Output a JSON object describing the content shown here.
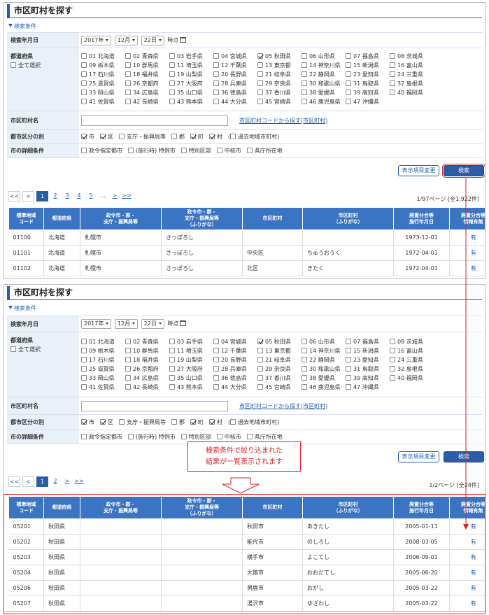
{
  "page_title": "市区町村を探す",
  "search_toggle": "検索条件",
  "labels": {
    "year_month": "検索年月日",
    "prefecture": "都道府県",
    "select_all": "全て選択",
    "municipality_name": "市区町村名",
    "municipality_type": "都市区分の別",
    "detail": "市の詳細条件"
  },
  "date": {
    "year": "2017年",
    "month": "12月",
    "day": "22日",
    "suffix": "時点"
  },
  "prefectures": [
    "01 北海道",
    "02 青森県",
    "03 岩手県",
    "04 宮城県",
    "05 秋田県",
    "06 山形県",
    "07 福島県",
    "08 茨城県",
    "09 栃木県",
    "10 群馬県",
    "11 埼玉県",
    "12 千葉県",
    "13 東京都",
    "14 神奈川県",
    "15 新潟県",
    "16 富山県",
    "17 石川県",
    "18 福井県",
    "19 山梨県",
    "20 長野県",
    "21 岐阜県",
    "22 静岡県",
    "23 愛知県",
    "24 三重県",
    "25 滋賀県",
    "26 京都府",
    "27 大阪府",
    "28 兵庫県",
    "29 奈良県",
    "30 和歌山県",
    "31 鳥取県",
    "32 島根県",
    "33 岡山県",
    "34 広島県",
    "35 山口県",
    "36 徳島県",
    "37 香川県",
    "38 愛媛県",
    "39 高知県",
    "40 福岡県",
    "41 佐賀県",
    "42 長崎県",
    "43 熊本県",
    "44 大分県",
    "45 宮崎県",
    "46 鹿児島県",
    "47 沖縄県"
  ],
  "municipality_link": "市区町村コードから探す(市区町村)",
  "types": [
    "市",
    "区",
    "支庁・振興局等",
    "郡",
    "町",
    "村",
    "過去地域市町村)"
  ],
  "types_paren": "(",
  "details": [
    "政令指定都市",
    "(施行時) 特例市",
    "特別区部",
    "中核市",
    "県庁所在地"
  ],
  "buttons": {
    "columns": "表示項目変更",
    "search": "検索"
  },
  "pager1": {
    "items": [
      "<<",
      "<",
      "1",
      "2",
      "3",
      "4",
      "5",
      "…",
      ">",
      ">>"
    ],
    "count": "1/97ページ [全1,922件]"
  },
  "pager2": {
    "items": [
      "<<",
      "<",
      "1",
      "2",
      ">",
      ">>"
    ],
    "count": "1/2ページ [全24件]"
  },
  "table_headers": [
    "標準地域\nコード",
    "都道府県",
    "政令市・郡・\n支庁・振興局等",
    "政令市・郡・\n支庁・振興局等\n（ふりがな）",
    "市区町村",
    "市区町村\n（ふりがな）",
    "廃置分合等\n施行年月日",
    "廃置分合等\n情報有無"
  ],
  "rows1": [
    [
      "01100",
      "北海道",
      "札幌市",
      "さっぽろし",
      "",
      "",
      "1973-12-01",
      "有"
    ],
    [
      "01101",
      "北海道",
      "札幌市",
      "さっぽろし",
      "中央区",
      "ちゅうおうく",
      "1972-04-01",
      "有"
    ],
    [
      "01102",
      "北海道",
      "札幌市",
      "さっぽろし",
      "北区",
      "きたく",
      "1972-04-01",
      "有"
    ]
  ],
  "rows2": [
    [
      "05201",
      "秋田県",
      "",
      "",
      "秋田市",
      "あきたし",
      "2005-01-11",
      "有"
    ],
    [
      "05202",
      "秋田県",
      "",
      "",
      "能代市",
      "のしろし",
      "2008-03-05",
      "有"
    ],
    [
      "05203",
      "秋田県",
      "",
      "",
      "横手市",
      "よこてし",
      "2006-09-01",
      "有"
    ],
    [
      "05204",
      "秋田県",
      "",
      "",
      "大館市",
      "おおだてし",
      "2005-06-20",
      "有"
    ],
    [
      "05206",
      "秋田県",
      "",
      "",
      "男鹿市",
      "おがし",
      "2005-03-22",
      "有"
    ],
    [
      "05207",
      "秋田県",
      "",
      "",
      "湯沢市",
      "ゆざわし",
      "2005-03-22",
      "有"
    ]
  ],
  "callout": [
    "検索条件で絞り込まれた",
    "結果が一覧表示されます"
  ],
  "colors": {
    "accent": "#2a5ca8",
    "header": "#3b74c2",
    "annotation": "#e02020"
  }
}
